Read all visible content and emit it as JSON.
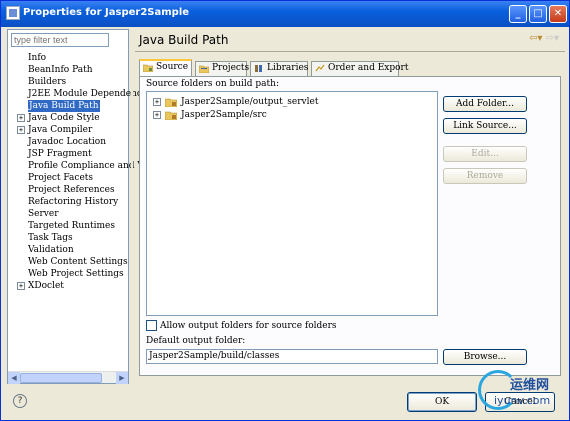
{
  "window": {
    "title": "Properties for Jasper2Sample",
    "min": "_",
    "max": "□",
    "close": "✕"
  },
  "left": {
    "filter_placeholder": "type filter text",
    "items": [
      {
        "label": "Info",
        "expandable": false
      },
      {
        "label": "BeanInfo Path",
        "expandable": false
      },
      {
        "label": "Builders",
        "expandable": false
      },
      {
        "label": "J2EE Module Dependenc",
        "expandable": false
      },
      {
        "label": "Java Build Path",
        "expandable": false,
        "selected": true
      },
      {
        "label": "Java Code Style",
        "expandable": true
      },
      {
        "label": "Java Compiler",
        "expandable": true
      },
      {
        "label": "Javadoc Location",
        "expandable": false
      },
      {
        "label": "JSP Fragment",
        "expandable": false
      },
      {
        "label": "Profile Compliance and V",
        "expandable": false
      },
      {
        "label": "Project Facets",
        "expandable": false
      },
      {
        "label": "Project References",
        "expandable": false
      },
      {
        "label": "Refactoring History",
        "expandable": false
      },
      {
        "label": "Server",
        "expandable": false
      },
      {
        "label": "Targeted Runtimes",
        "expandable": false
      },
      {
        "label": "Task Tags",
        "expandable": false
      },
      {
        "label": "Validation",
        "expandable": false
      },
      {
        "label": "Web Content Settings",
        "expandable": false
      },
      {
        "label": "Web Project Settings",
        "expandable": false
      },
      {
        "label": "XDoclet",
        "expandable": true
      }
    ]
  },
  "right": {
    "title": "Java Build Path",
    "tabs": [
      {
        "label": "Source",
        "icon": "source-folder-icon",
        "active": true
      },
      {
        "label": "Projects",
        "icon": "projects-icon"
      },
      {
        "label": "Libraries",
        "icon": "libraries-icon"
      },
      {
        "label": "Order and Export",
        "icon": "order-export-icon"
      }
    ],
    "source_label": "Source folders on build path:",
    "folders": [
      "Jasper2Sample/output_servlet",
      "Jasper2Sample/src"
    ],
    "buttons": {
      "add": "Add Folder...",
      "link": "Link Source...",
      "edit": "Edit...",
      "remove": "Remove",
      "browse": "Browse..."
    },
    "allow_output_label": "Allow output folders for source folders",
    "default_output_label": "Default output folder:",
    "default_output_value": "Jasper2Sample/build/classes"
  },
  "bottom": {
    "help": "?",
    "ok": "OK",
    "cancel": "Cancel"
  },
  "watermark": {
    "line1": "运维网",
    "line2": "iyunv.com"
  }
}
